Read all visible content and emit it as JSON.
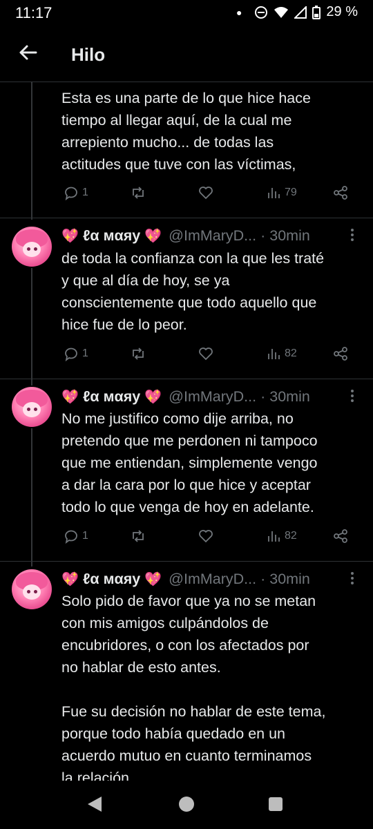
{
  "status_bar": {
    "time": "11:17",
    "battery": "29 %"
  },
  "header": {
    "title": "Hilo"
  },
  "tweets": [
    {
      "text": "Esta es una parte de lo que hice hace\ntiempo al llegar aquí, de la cual me\narrepiento mucho... de todas las\nactitudes que tuve con las víctimas,",
      "replies": "1",
      "views": "79"
    },
    {
      "name": "ℓα мαяу",
      "handle": "@ImMaryD...",
      "separator": "·",
      "age": "30min",
      "text": "de toda la confianza con la que les traté\ny que al día de hoy, se ya\nconscientemente que todo aquello que\nhice fue de lo peor.",
      "replies": "1",
      "views": "82"
    },
    {
      "name": "ℓα мαяу",
      "handle": "@ImMaryD...",
      "separator": "·",
      "age": "30min",
      "text": "No me justifico como dije arriba, no\npretendo que me perdonen ni tampoco\nque me entiendan, simplemente vengo\na dar la cara por lo que hice y aceptar\ntodo lo que venga de hoy en adelante.",
      "replies": "1",
      "views": "82"
    },
    {
      "name": "ℓα мαяу",
      "handle": "@ImMaryD...",
      "separator": "·",
      "age": "30min",
      "text": "Solo pido de favor que ya no se metan\ncon mis amigos culpándolos de\nencubridores, o con los afectados por\nno hablar de esto antes.\n\nFue su decisión no hablar de este tema,\nporque todo había quedado en un\nacuerdo mutuo en cuanto terminamos\nla relación."
    }
  ],
  "emoji": {
    "heart": "💖",
    "sparkle": "✨"
  }
}
